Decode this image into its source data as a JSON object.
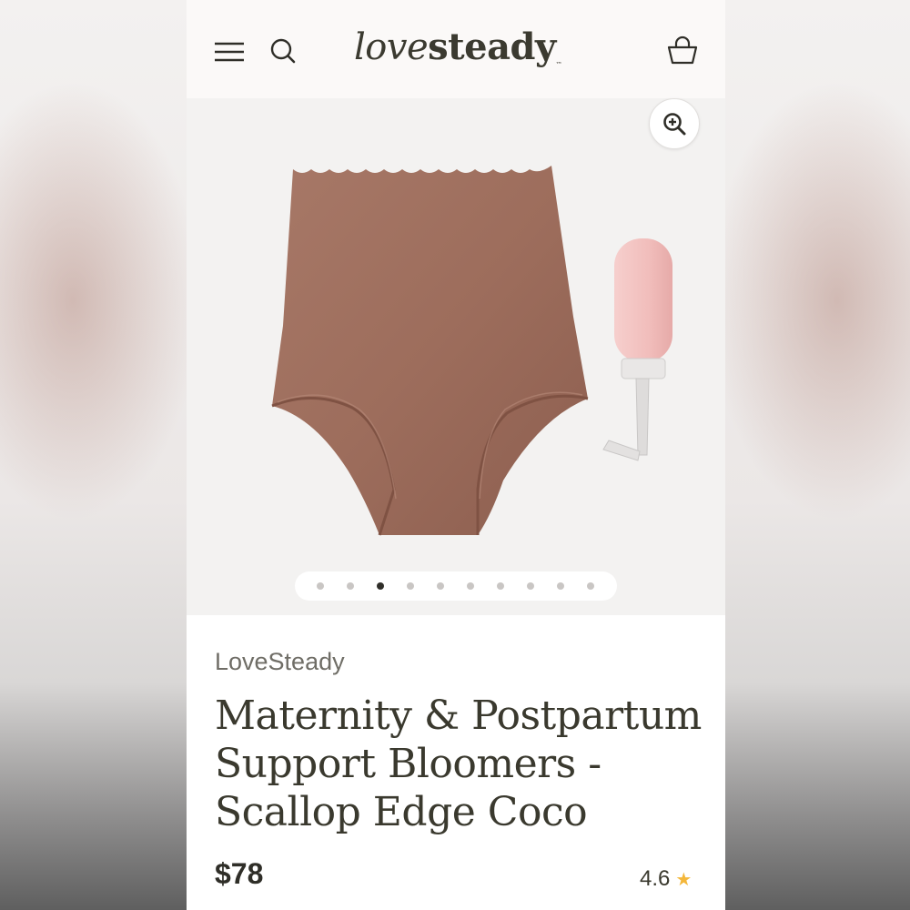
{
  "header": {
    "logo_light": "love",
    "logo_bold": "steady",
    "logo_tm": "™",
    "icons": [
      "menu-icon",
      "search-icon",
      "cart-icon"
    ]
  },
  "gallery": {
    "zoom_icon": "zoom-in-icon",
    "slide_count": 10,
    "active_slide": 3
  },
  "product": {
    "brand": "LoveSteady",
    "title": "Maternity & Postpartum Support Bloomers - Scallop Edge Coco",
    "price": "$78",
    "rating": "4.6",
    "rating_icon": "star-icon"
  },
  "colors": {
    "text_dark": "#3a392e",
    "star": "#f4b73a",
    "product_brown": "#a0705f",
    "bottle_pink": "#f2c4c2"
  }
}
